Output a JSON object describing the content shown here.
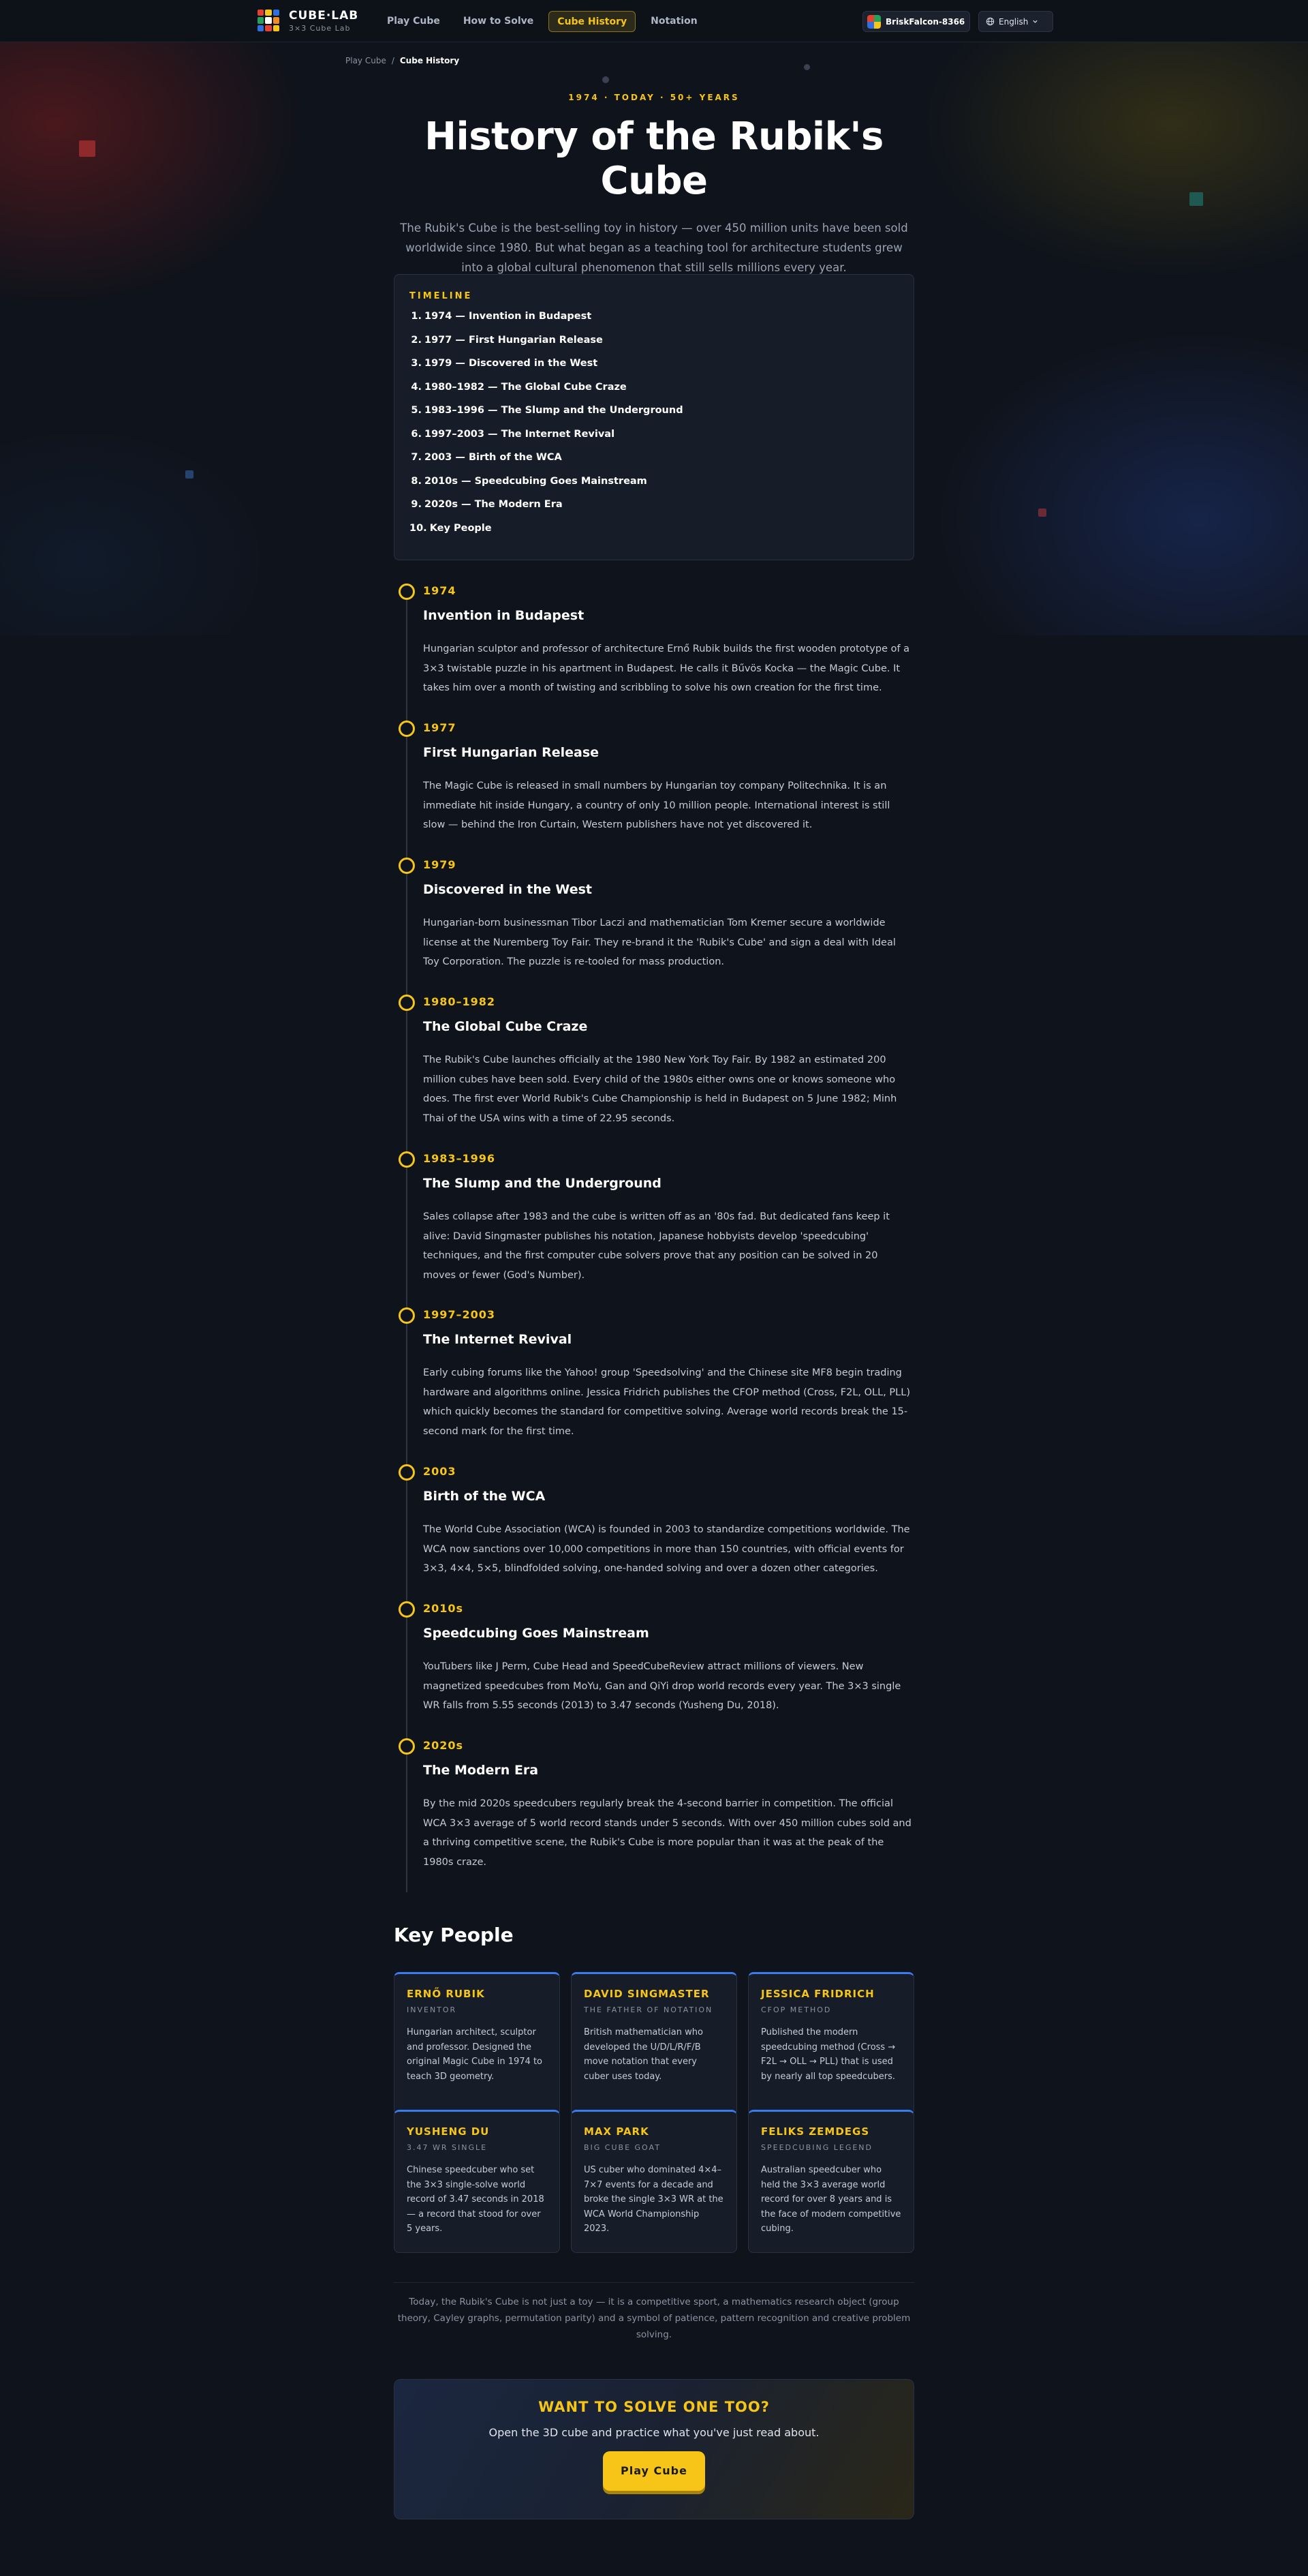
{
  "header": {
    "brand_name": "CUBE·LAB",
    "brand_sub": "3×3 Cube Lab",
    "nav": [
      "Play Cube",
      "How to Solve",
      "Cube History",
      "Notation"
    ],
    "active_nav": "Cube History",
    "username": "BriskFalcon-8366",
    "language": "English"
  },
  "breadcrumb": {
    "home": "Play Cube",
    "separator": "/",
    "current": "Cube History"
  },
  "hero": {
    "eyebrow": "1974 · TODAY · 50+ YEARS",
    "title": "History of the Rubik's Cube",
    "intro": "The Rubik's Cube is the best-selling toy in history — over 450 million units have been sold worldwide since 1980. But what began as a teaching tool for architecture students grew into a global cultural phenomenon that still sells millions every year."
  },
  "toc": {
    "title": "TIMELINE",
    "items": [
      "1974 — Invention in Budapest",
      "1977 — First Hungarian Release",
      "1979 — Discovered in the West",
      "1980–1982 — The Global Cube Craze",
      "1983–1996 — The Slump and the Underground",
      "1997–2003 — The Internet Revival",
      "2003 — Birth of the WCA",
      "2010s — Speedcubing Goes Mainstream",
      "2020s — The Modern Era",
      "Key People"
    ]
  },
  "timeline": [
    {
      "year": "1974",
      "title": "Invention in Budapest",
      "body": "Hungarian sculptor and professor of architecture Ernő Rubik builds the first wooden prototype of a 3×3 twistable puzzle in his apartment in Budapest. He calls it Bűvös Kocka — the Magic Cube. It takes him over a month of twisting and scribbling to solve his own creation for the first time."
    },
    {
      "year": "1977",
      "title": "First Hungarian Release",
      "body": "The Magic Cube is released in small numbers by Hungarian toy company Politechnika. It is an immediate hit inside Hungary, a country of only 10 million people. International interest is still slow — behind the Iron Curtain, Western publishers have not yet discovered it."
    },
    {
      "year": "1979",
      "title": "Discovered in the West",
      "body": "Hungarian-born businessman Tibor Laczi and mathematician Tom Kremer secure a worldwide license at the Nuremberg Toy Fair. They re-brand it the 'Rubik's Cube' and sign a deal with Ideal Toy Corporation. The puzzle is re-tooled for mass production."
    },
    {
      "year": "1980–1982",
      "title": "The Global Cube Craze",
      "body": "The Rubik's Cube launches officially at the 1980 New York Toy Fair. By 1982 an estimated 200 million cubes have been sold. Every child of the 1980s either owns one or knows someone who does. The first ever World Rubik's Cube Championship is held in Budapest on 5 June 1982; Minh Thai of the USA wins with a time of 22.95 seconds."
    },
    {
      "year": "1983–1996",
      "title": "The Slump and the Underground",
      "body": "Sales collapse after 1983 and the cube is written off as an '80s fad. But dedicated fans keep it alive: David Singmaster publishes his notation, Japanese hobbyists develop 'speedcubing' techniques, and the first computer cube solvers prove that any position can be solved in 20 moves or fewer (God's Number)."
    },
    {
      "year": "1997–2003",
      "title": "The Internet Revival",
      "body": "Early cubing forums like the Yahoo! group 'Speedsolving' and the Chinese site MF8 begin trading hardware and algorithms online. Jessica Fridrich publishes the CFOP method (Cross, F2L, OLL, PLL) which quickly becomes the standard for competitive solving. Average world records break the 15-second mark for the first time."
    },
    {
      "year": "2003",
      "title": "Birth of the WCA",
      "body": "The World Cube Association (WCA) is founded in 2003 to standardize competitions worldwide. The WCA now sanctions over 10,000 competitions in more than 150 countries, with official events for 3×3, 4×4, 5×5, blindfolded solving, one-handed solving and over a dozen other categories."
    },
    {
      "year": "2010s",
      "title": "Speedcubing Goes Mainstream",
      "body": "YouTubers like J Perm, Cube Head and SpeedCubeReview attract millions of viewers. New magnetized speedcubes from MoYu, Gan and QiYi drop world records every year. The 3×3 single WR falls from 5.55 seconds (2013) to 3.47 seconds (Yusheng Du, 2018)."
    },
    {
      "year": "2020s",
      "title": "The Modern Era",
      "body": "By the mid 2020s speedcubers regularly break the 4-second barrier in competition. The official WCA 3×3 average of 5 world record stands under 5 seconds. With over 450 million cubes sold and a thriving competitive scene, the Rubik's Cube is more popular than it was at the peak of the 1980s craze."
    }
  ],
  "key_people": {
    "title": "Key People",
    "people": [
      {
        "name": "ERNŐ RUBIK",
        "role": "INVENTOR",
        "desc": "Hungarian architect, sculptor and professor. Designed the original Magic Cube in 1974 to teach 3D geometry."
      },
      {
        "name": "DAVID SINGMASTER",
        "role": "THE FATHER OF NOTATION",
        "desc": "British mathematician who developed the U/D/L/R/F/B move notation that every cuber uses today."
      },
      {
        "name": "JESSICA FRIDRICH",
        "role": "CFOP METHOD",
        "desc": "Published the modern speedcubing method (Cross → F2L → OLL → PLL) that is used by nearly all top speedcubers."
      },
      {
        "name": "YUSHENG DU",
        "role": "3.47 WR SINGLE",
        "desc": "Chinese speedcuber who set the 3×3 single-solve world record of 3.47 seconds in 2018 — a record that stood for over 5 years."
      },
      {
        "name": "MAX PARK",
        "role": "BIG CUBE GOAT",
        "desc": "US cuber who dominated 4×4–7×7 events for a decade and broke the single 3×3 WR at the WCA World Championship 2023."
      },
      {
        "name": "FELIKS ZEMDEGS",
        "role": "SPEEDCUBING LEGEND",
        "desc": "Australian speedcuber who held the 3×3 average world record for over 8 years and is the face of modern competitive cubing."
      }
    ]
  },
  "closing": "Today, the Rubik's Cube is not just a toy — it is a competitive sport, a mathematics research object (group theory, Cayley graphs, permutation parity) and a symbol of patience, pattern recognition and creative problem solving.",
  "cta": {
    "title": "WANT TO SOLVE ONE TOO?",
    "text": "Open the 3D cube and practice what you've just read about.",
    "button": "Play Cube"
  },
  "colors": {
    "accent": "#f6c518",
    "card_top": "#3a7bf0",
    "background": "#0f131b"
  },
  "icons": {
    "logo": "cube-logo-icon",
    "language": "globe-icon",
    "dropdown": "chevron-down-icon"
  }
}
